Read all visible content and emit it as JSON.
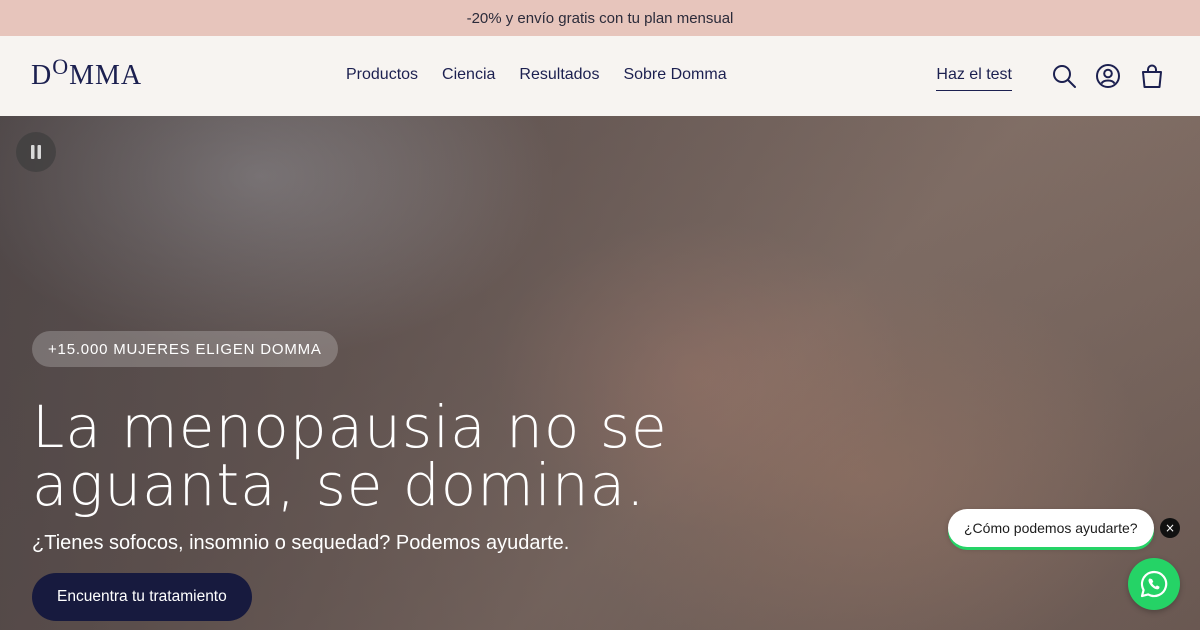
{
  "promo": {
    "text": "-20% y envío gratis con tu plan mensual"
  },
  "header": {
    "logo": {
      "prefix": "D",
      "raised": "O",
      "suffix": "MMA"
    },
    "nav": [
      "Productos",
      "Ciencia",
      "Resultados",
      "Sobre Domma"
    ],
    "test_link": "Haz el test",
    "icons": [
      "search-icon",
      "account-icon",
      "cart-icon"
    ]
  },
  "hero": {
    "badge": "+15.000 MUJERES ELIGEN DOMMA",
    "title_line1": "La menopausia no se",
    "title_line2": "aguanta, se domina.",
    "subtitle": "¿Tienes sofocos, insomnio o sequedad? Podemos ayudarte.",
    "cta": "Encuentra tu tratamiento"
  },
  "chat": {
    "bubble": "¿Cómo podemos ayudarte?",
    "close_symbol": "×"
  },
  "colors": {
    "promo_bg": "#e7c5bc",
    "header_bg": "#f7f4f1",
    "brand_navy": "#1c2050",
    "cta_bg": "#171a3e",
    "whatsapp_green": "#25d366"
  }
}
